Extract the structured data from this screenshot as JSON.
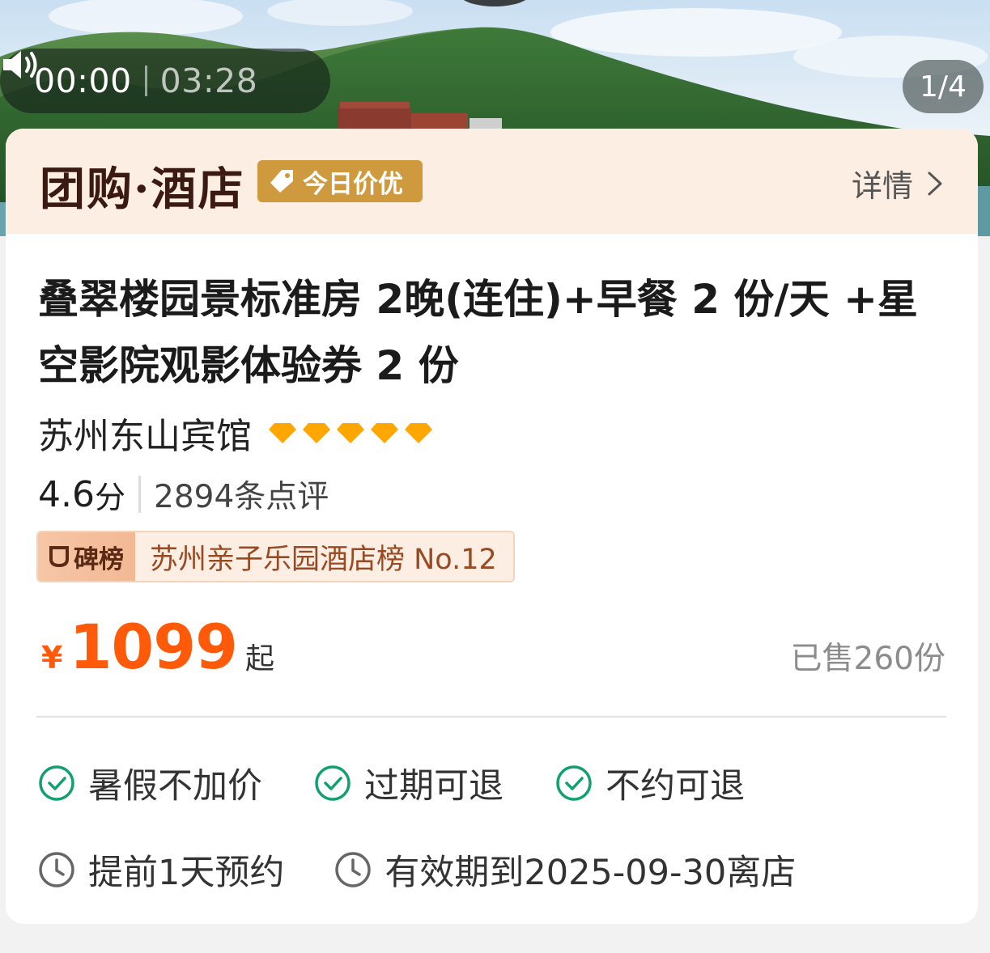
{
  "audio": {
    "icon": "speaker-icon",
    "current_time": "00:00",
    "duration": "03:28"
  },
  "gallery": {
    "page_indicator": "1/4"
  },
  "header": {
    "brand": "团购·酒店",
    "deal_tag": "今日价优",
    "deal_tag_icon": "price-tag-icon",
    "detail_link": "详情",
    "detail_icon": "chevron-right-icon"
  },
  "product": {
    "title": "叠翠楼园景标准房 2晚(连住)+早餐 2 份/天 +星空影院观影体验券 2 份",
    "hotel_name": "苏州东山宾馆",
    "diamond_count": 5,
    "diamond_color": "#ffa600",
    "score": "4.6",
    "score_unit": "分",
    "reviews": "2894条点评",
    "rank_label": "碑榜",
    "rank_text": "苏州亲子乐园酒店榜 No.12"
  },
  "price": {
    "currency": "¥",
    "value": "1099",
    "suffix": "起",
    "color": "#ff5a0a",
    "sold": "已售260份"
  },
  "features": [
    {
      "icon": "check-circle-icon",
      "label": "暑假不加价"
    },
    {
      "icon": "check-circle-icon",
      "label": "过期可退"
    },
    {
      "icon": "check-circle-icon",
      "label": "不约可退"
    }
  ],
  "notes": [
    {
      "icon": "clock-icon",
      "label": "提前1天预约"
    },
    {
      "icon": "clock-icon",
      "label": "有效期到2025-09-30离店"
    }
  ],
  "colors": {
    "accent_green": "#12a070",
    "header_bg": "#fdeee3",
    "tag_gold": "#cf9a3e"
  }
}
